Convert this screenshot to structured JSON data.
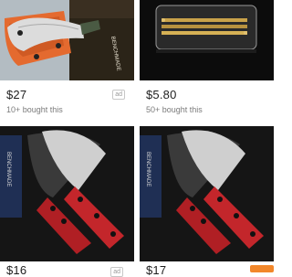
{
  "listings": [
    {
      "price": "$27",
      "bought": "10+ bought this",
      "ad": "ad"
    },
    {
      "price": "$5.80",
      "bought": "50+ bought this"
    },
    {
      "price": "$16",
      "ad": "ad"
    },
    {
      "price": "$17"
    }
  ],
  "colors": {
    "orange": "#f2872a",
    "red_handle": "#b01f24",
    "dark_bg": "#151515"
  }
}
